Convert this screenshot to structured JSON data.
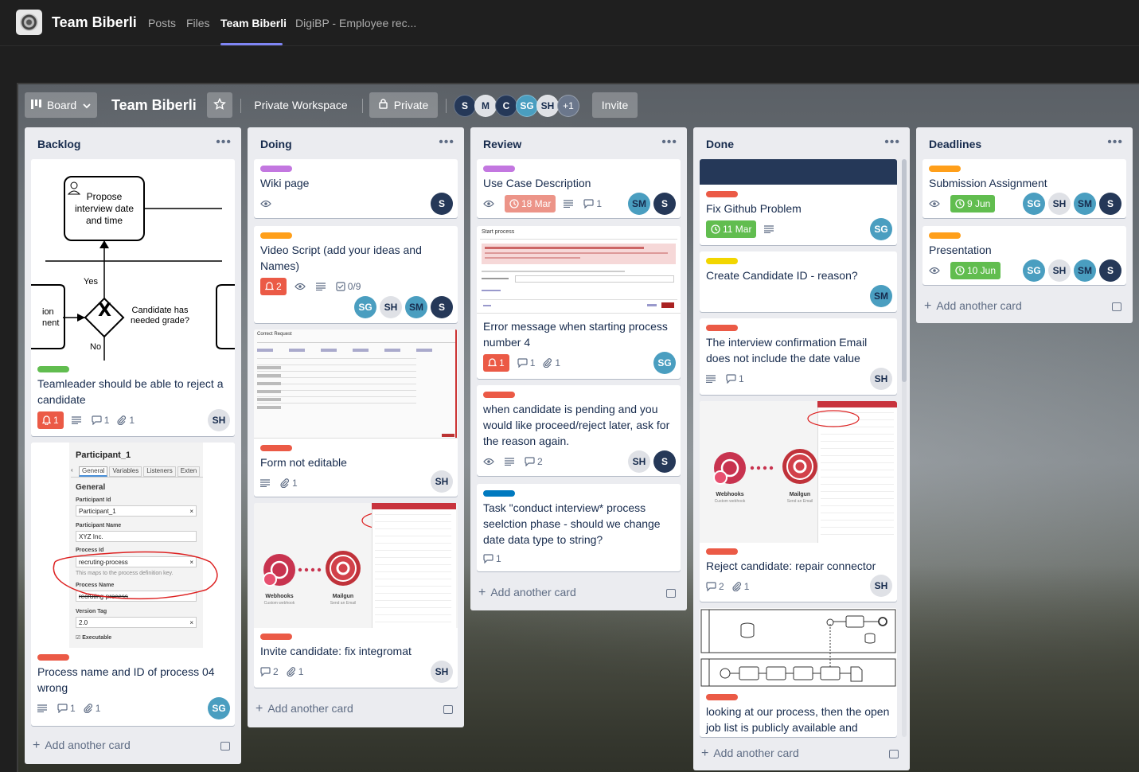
{
  "teams": {
    "team_name": "Team Biberli",
    "tabs": [
      "Posts",
      "Files",
      "Team Biberli",
      "DigiBP - Employee rec..."
    ],
    "active_tab_index": 2
  },
  "board_header": {
    "view_label": "Board",
    "title": "Team Biberli",
    "workspace_label": "Private Workspace",
    "visibility_label": "Private",
    "members": [
      "S",
      "M",
      "C",
      "SG",
      "SH"
    ],
    "more_members": "+1",
    "invite_label": "Invite"
  },
  "colors": {
    "label_green": "#61bd4f",
    "label_orange": "#ff9f1a",
    "label_red": "#eb5a46",
    "label_purple": "#c377e0",
    "label_yellow": "#f2d600",
    "label_blue": "#0079bf",
    "due_overdue": "#ec9488",
    "due_complete": "#61bd4f"
  },
  "add_card_label": "Add another card",
  "lists": [
    {
      "title": "Backlog",
      "cards": [
        {
          "cover_diagram": {
            "task": "Propose interview date and time",
            "gateway": "Candidate has needed grade?",
            "yes": "Yes",
            "no": "No",
            "left_cut": "ion\nnent"
          },
          "label": "green",
          "title": "Teamleader should be able to reject a candidate",
          "notifications": "1",
          "comments": "1",
          "attachments": "1",
          "members": [
            "SH"
          ]
        },
        {
          "cover_form": {
            "heading": "Participant_1",
            "tabs": [
              "General",
              "Variables",
              "Listeners",
              "Exten"
            ],
            "section": "General",
            "participant_id_label": "Participant Id",
            "participant_id": "Participant_1",
            "participant_name_label": "Participant Name",
            "participant_name": "XYZ Inc.",
            "process_id_label": "Process Id",
            "process_id": "recruting-process",
            "hint": "This maps to the process definition key.",
            "process_name_label": "Process Name",
            "process_name": "recruting-process",
            "version_tag_label": "Version Tag",
            "version_tag": "2.0",
            "executable_label": "Executable"
          },
          "label": "red",
          "title": "Process name and ID of process 04 wrong",
          "comments": "1",
          "attachments": "1",
          "members": [
            "SG"
          ]
        }
      ]
    },
    {
      "title": "Doing",
      "cards": [
        {
          "label": "purple",
          "title": "Wiki page",
          "members": [
            "S"
          ]
        },
        {
          "label": "orange",
          "title": "Video Script (add your ideas and Names)",
          "notifications": "2",
          "checklist": "0/9",
          "members": [
            "SG",
            "SH",
            "SM",
            "S"
          ]
        },
        {
          "cover_doc": {
            "heading": "Correct Request"
          },
          "label": "red",
          "title": "Form not editable",
          "attachments": "1",
          "members": [
            "SH"
          ]
        },
        {
          "cover_integration": {
            "left": "Webhooks",
            "left_sub": "Custom webhook",
            "right": "Mailgun",
            "right_sub": "Send an Email"
          },
          "label": "red",
          "title": "Invite candidate: fix integromat",
          "comments": "2",
          "attachments": "1",
          "members": [
            "SH"
          ]
        }
      ]
    },
    {
      "title": "Review",
      "cards": [
        {
          "label": "purple",
          "title": "Use Case Description",
          "due": "18 Mar",
          "comments": "1",
          "members": [
            "SM",
            "S"
          ]
        },
        {
          "cover_error": {
            "heading": "Start process"
          },
          "title": "Error message when starting process number 4",
          "notifications": "1",
          "comments": "1",
          "attachments": "1",
          "members": [
            "SG"
          ]
        },
        {
          "label": "red",
          "title": "when candidate is pending and you would like proceed/reject later, ask for the reason again.",
          "comments": "2",
          "members": [
            "SH",
            "S"
          ]
        },
        {
          "label": "blue",
          "title": "Task \"conduct interview* process seelction phase - should we change date data type to string?",
          "comments": "1"
        }
      ]
    },
    {
      "title": "Done",
      "cards": [
        {
          "cover_color": "#253858",
          "label": "red",
          "title": "Fix Github Problem",
          "due": "11 Mar",
          "members": [
            "SG"
          ]
        },
        {
          "label": "yellow",
          "title": "Create Candidate ID - reason?",
          "members": [
            "SM"
          ]
        },
        {
          "label": "red",
          "title": "The interview confirmation Email does not include the date value",
          "comments": "1",
          "members": [
            "SH"
          ]
        },
        {
          "cover_integration": {
            "left": "Webhooks",
            "left_sub": "Custom webhook",
            "right": "Mailgun",
            "right_sub": "Send an Email"
          },
          "label": "red",
          "title": "Reject candidate: repair connector",
          "comments": "2",
          "attachments": "1",
          "members": [
            "SH"
          ]
        },
        {
          "cover_bpmn": true,
          "label": "red",
          "title": "looking at our process, then the open job list is publicly available and"
        }
      ]
    },
    {
      "title": "Deadlines",
      "cards": [
        {
          "label": "orange",
          "title": "Submission Assignment",
          "due": "9 Jun",
          "members": [
            "SG",
            "SH",
            "SM",
            "S"
          ]
        },
        {
          "label": "orange",
          "title": "Presentation",
          "due": "10 Jun",
          "members": [
            "SG",
            "SH",
            "SM",
            "S"
          ]
        }
      ]
    }
  ]
}
